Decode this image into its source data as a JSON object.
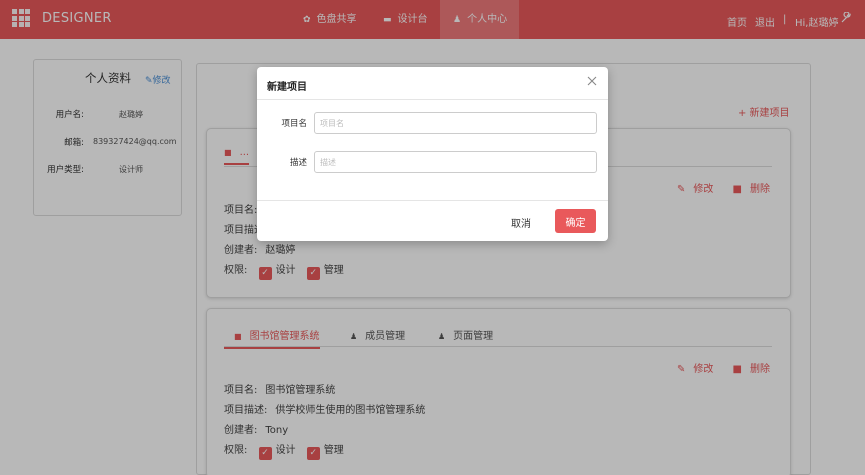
{
  "colors": {
    "brand": "#e9595b",
    "link": "#4a8fd6",
    "overlay": "rgba(0,0,0,0.28)"
  },
  "nav": {
    "brand": "DESIGNER",
    "items": [
      {
        "label": "色盘共享",
        "icon": "palette-icon"
      },
      {
        "label": "设计台",
        "icon": "monitor-icon"
      },
      {
        "label": "个人中心",
        "icon": "user-icon",
        "active": true
      }
    ],
    "home": "首页",
    "logout": "退出",
    "separator": "|",
    "greeting": "Hi,赵璐婷"
  },
  "profile": {
    "title": "个人资料",
    "edit": "修改",
    "fields": [
      {
        "label": "用户名:",
        "value": "赵璐婷"
      },
      {
        "label": "邮箱:",
        "value": "839327424@qq.com"
      },
      {
        "label": "用户类型:",
        "value": "设计师"
      }
    ]
  },
  "new_project_link": "+ 新建项目",
  "project1": {
    "tab_visible": "...",
    "edit": "修改",
    "delete": "删除",
    "rows": {
      "name_label": "项目名:",
      "desc_label": "项目描述:",
      "creator_label": "创建者:",
      "creator": "赵璐婷",
      "perm_label": "权限:",
      "perm_design": "设计",
      "perm_manage": "管理"
    }
  },
  "project2": {
    "tabs": [
      "图书馆管理系统",
      "成员管理",
      "页面管理"
    ],
    "edit": "修改",
    "delete": "删除",
    "name_label": "项目名:",
    "name": "图书馆管理系统",
    "desc_label": "项目描述:",
    "desc": "供学校师生使用的图书馆管理系统",
    "creator_label": "创建者:",
    "creator": "Tony",
    "perm_label": "权限:",
    "perm_design": "设计",
    "perm_manage": "管理"
  },
  "modal": {
    "title": "新建项目",
    "name_label": "项目名",
    "name_placeholder": "项目名",
    "desc_label": "描述",
    "desc_placeholder": "描述",
    "cancel": "取消",
    "confirm": "确定"
  }
}
